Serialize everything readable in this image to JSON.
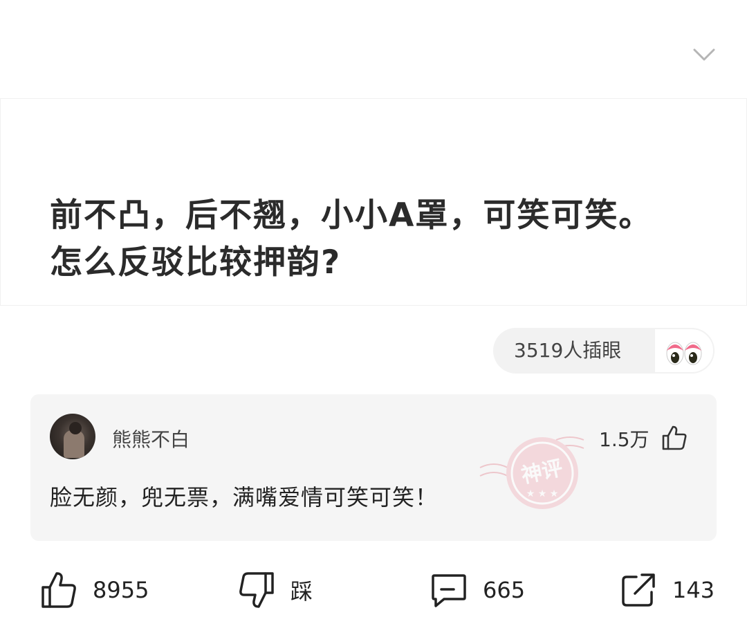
{
  "post": {
    "text": "前不凸，后不翘，小小A罩，可笑可笑。怎么反驳比较押韵?"
  },
  "reaction": {
    "count_label": "3519人插眼",
    "emoji": "eyes-emoji"
  },
  "top_comment": {
    "username": "熊熊不白",
    "likes": "1.5万",
    "text": "脸无颜，兜无票，满嘴爱情可笑可笑！",
    "badge": "神评",
    "badge_color": "#e8a0aa"
  },
  "actions": {
    "like_count": "8955",
    "dislike_label": "踩",
    "comment_count": "665",
    "share_count": "143"
  }
}
